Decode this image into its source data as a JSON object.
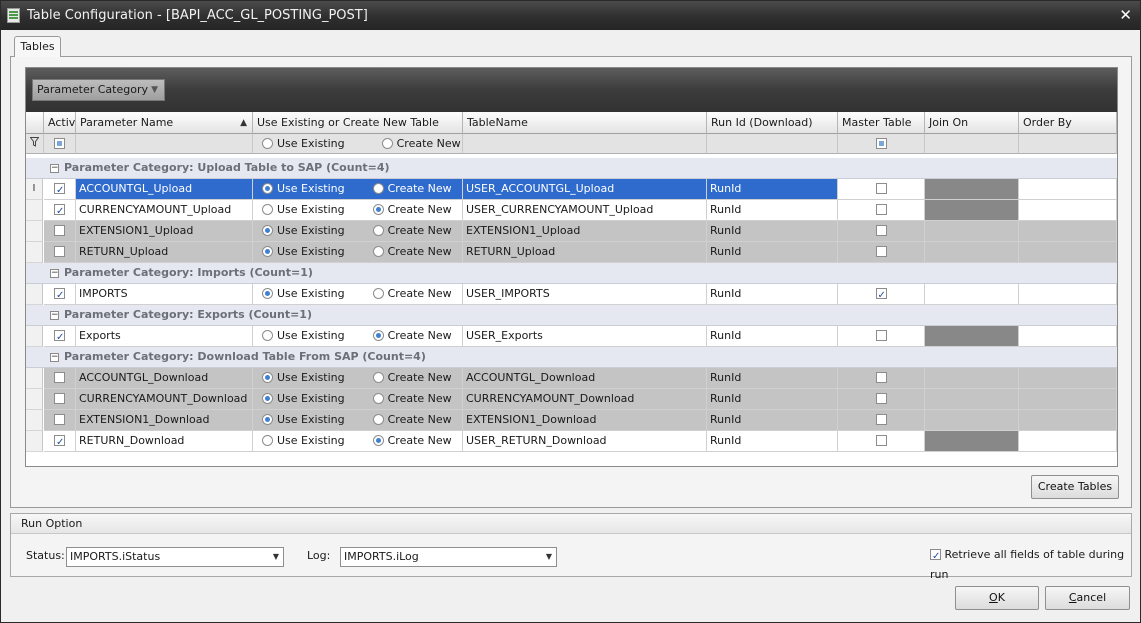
{
  "window": {
    "title": "Table Configuration - [BAPI_ACC_GL_POSTING_POST]",
    "close_glyph": "✕"
  },
  "tab": {
    "label": "Tables"
  },
  "group_panel": {
    "chip_label": "Parameter Category",
    "chip_sort_glyph": "▼"
  },
  "columns": {
    "active": "Active",
    "param_name": "Parameter Name",
    "use_existing_or_new": "Use Existing or Create New Table",
    "table_name": "TableName",
    "run_id": "Run Id (Download)",
    "master_table": "Master Table",
    "join_on": "Join On",
    "order_by": "Order By",
    "sort_glyph": "▲"
  },
  "filter_row": {
    "use_existing": "Use Existing",
    "create_new": "Create New"
  },
  "radio_labels": {
    "use_existing": "Use Existing",
    "create_new": "Create New"
  },
  "groups": [
    {
      "label": "Parameter Category: Upload Table to SAP (Count=4)",
      "rows": [
        {
          "name": "ACCOUNTGL_Upload",
          "active": true,
          "mode": "existing",
          "table": "USER_ACCOUNTGL_Upload",
          "run_id": "RunId",
          "master": false,
          "style": "selected"
        },
        {
          "name": "CURRENCYAMOUNT_Upload",
          "active": true,
          "mode": "new",
          "table": "USER_CURRENCYAMOUNT_Upload",
          "run_id": "RunId",
          "master": false,
          "style": "white"
        },
        {
          "name": "EXTENSION1_Upload",
          "active": false,
          "mode": "existing",
          "table": "EXTENSION1_Upload",
          "run_id": "RunId",
          "master": false,
          "style": "gray"
        },
        {
          "name": "RETURN_Upload",
          "active": false,
          "mode": "existing",
          "table": "RETURN_Upload",
          "run_id": "RunId",
          "master": false,
          "style": "gray"
        }
      ]
    },
    {
      "label": "Parameter Category: Imports (Count=1)",
      "rows": [
        {
          "name": "IMPORTS",
          "active": true,
          "mode": "existing",
          "table": "USER_IMPORTS",
          "run_id": "RunId",
          "master": true,
          "style": "white"
        }
      ]
    },
    {
      "label": "Parameter Category: Exports (Count=1)",
      "rows": [
        {
          "name": "Exports",
          "active": true,
          "mode": "new",
          "table": "USER_Exports",
          "run_id": "RunId",
          "master": false,
          "style": "white"
        }
      ]
    },
    {
      "label": "Parameter Category: Download Table From SAP (Count=4)",
      "rows": [
        {
          "name": "ACCOUNTGL_Download",
          "active": false,
          "mode": "existing",
          "table": "ACCOUNTGL_Download",
          "run_id": "RunId",
          "master": false,
          "style": "gray"
        },
        {
          "name": "CURRENCYAMOUNT_Download",
          "active": false,
          "mode": "existing",
          "table": "CURRENCYAMOUNT_Download",
          "run_id": "RunId",
          "master": false,
          "style": "gray"
        },
        {
          "name": "EXTENSION1_Download",
          "active": false,
          "mode": "existing",
          "table": "EXTENSION1_Download",
          "run_id": "RunId",
          "master": false,
          "style": "gray"
        },
        {
          "name": "RETURN_Download",
          "active": true,
          "mode": "new",
          "table": "USER_RETURN_Download",
          "run_id": "RunId",
          "master": false,
          "style": "white"
        }
      ]
    }
  ],
  "create_tables_button": "Create Tables",
  "run_option": {
    "legend": "Run Option",
    "status_label": "Status:",
    "status_value": "IMPORTS.iStatus",
    "log_label": "Log:",
    "log_value": "IMPORTS.iLog",
    "retrieve_label": "Retrieve all fields of table during run",
    "retrieve_checked": true,
    "combo_arrow": "▼"
  },
  "buttons": {
    "ok_mnemonic": "O",
    "ok_rest": "K",
    "cancel_mnemonic": "C",
    "cancel_rest": "ancel"
  },
  "colors": {
    "titlebar": "#2f2f2f",
    "selection": "#2f6bcd",
    "group_header_text": "#6b6f7a",
    "inactive_row": "#c4c4c4"
  }
}
